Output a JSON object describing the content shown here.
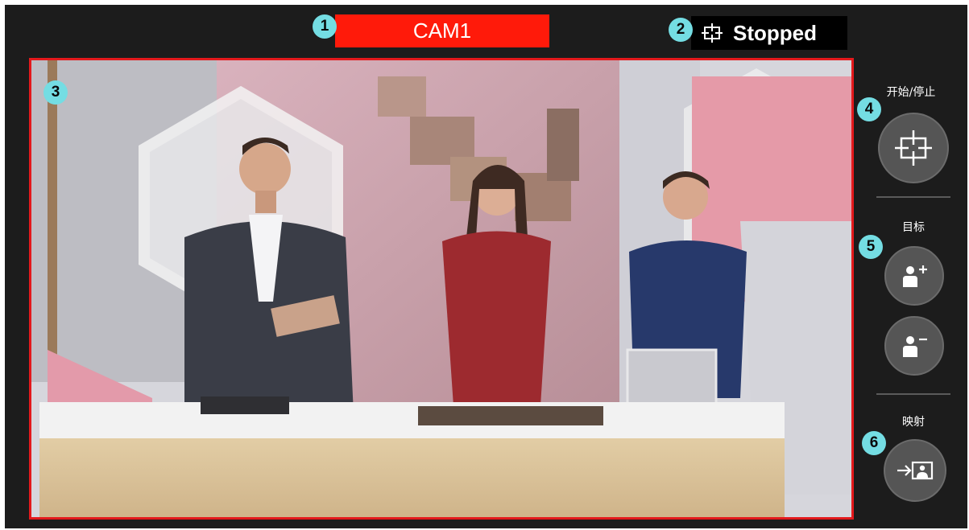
{
  "camera": {
    "name": "CAM1",
    "label_color": "#ff1a0a"
  },
  "status": {
    "text": "Stopped",
    "icon": "tracking-target-icon"
  },
  "badges": [
    "1",
    "2",
    "3",
    "4",
    "5",
    "6"
  ],
  "video": {
    "border_color": "#e3191c",
    "content": "studio-scene-three-presenters"
  },
  "controls": {
    "start_stop": {
      "label": "开始/停止",
      "icon": "tracking-target-icon"
    },
    "target": {
      "label": "目标",
      "add_icon": "person-add-icon",
      "remove_icon": "person-remove-icon"
    },
    "mapping": {
      "label": "映射",
      "icon": "map-to-screen-icon"
    }
  },
  "colors": {
    "badge": "#74dde3",
    "panel": "#1c1c1c",
    "button": "#555555"
  }
}
